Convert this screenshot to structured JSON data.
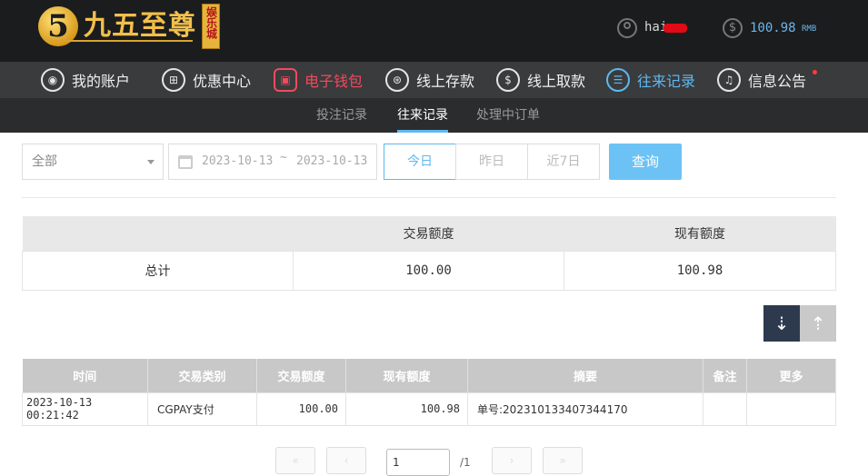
{
  "header": {
    "logo_text": "九五至尊",
    "logo_badge": "娱乐城",
    "username": "hai",
    "balance": "100.98",
    "balance_unit": "RMB"
  },
  "mainnav": [
    {
      "label": "我的账户",
      "icon": "user-icon"
    },
    {
      "label": "优惠中心",
      "icon": "gift-icon"
    },
    {
      "label": "电子钱包",
      "icon": "wallet-icon"
    },
    {
      "label": "线上存款",
      "icon": "deposit-icon"
    },
    {
      "label": "线上取款",
      "icon": "withdraw-icon"
    },
    {
      "label": "往来记录",
      "icon": "records-icon"
    },
    {
      "label": "信息公告",
      "icon": "bell-icon"
    }
  ],
  "subnav": [
    "投注记录",
    "往来记录",
    "处理中订单"
  ],
  "filter": {
    "type_value": "全部",
    "date_start": "2023-10-13",
    "date_sep": "~",
    "date_end": "2023-10-13",
    "quick": [
      "今日",
      "昨日",
      "近7日"
    ],
    "search_label": "查询"
  },
  "summary": {
    "headers": [
      "",
      "交易额度",
      "现有额度"
    ],
    "row": [
      "总计",
      "100.00",
      "100.98"
    ]
  },
  "records": {
    "headers": [
      "时间",
      "交易类别",
      "交易额度",
      "现有额度",
      "摘要",
      "备注",
      "更多"
    ],
    "rows": [
      [
        "2023-10-13 00:21:42",
        "CGPAY支付",
        "100.00",
        "100.98",
        "单号:202310133407344170",
        "",
        ""
      ]
    ]
  },
  "pagination": {
    "current": "1",
    "total": "/1"
  },
  "colors": {
    "accent": "#5db8f0",
    "wallet": "#ee4b5d",
    "header_bg": "#1b1c1e",
    "nav_bg": "#3a3b3d"
  }
}
